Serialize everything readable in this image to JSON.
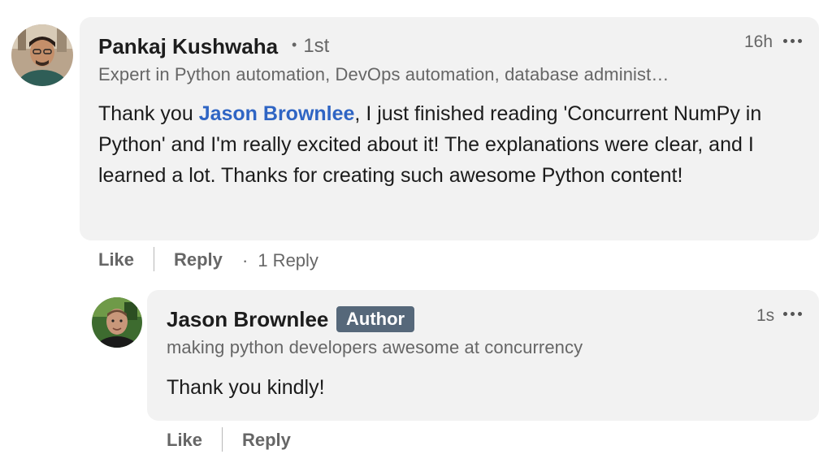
{
  "comment": {
    "author": "Pankaj Kushwaha",
    "degree": "1st",
    "headline": "Expert in Python automation, DevOps automation, database administ…",
    "time": "16h",
    "body_intro": "Thank you ",
    "mention": "Jason Brownlee",
    "body_rest": ", I just finished reading 'Concurrent NumPy in Python' and I'm really excited about it! The explanations were clear, and I learned a lot. Thanks for creating such awesome Python content!",
    "like_label": "Like",
    "reply_label": "Reply",
    "reply_count": "1 Reply",
    "more_icon": "more-dots-icon",
    "avatar_icon": "profile-photo"
  },
  "reply": {
    "author": "Jason Brownlee",
    "badge": "Author",
    "headline": "making python developers awesome at concurrency",
    "time": "1s",
    "body": "Thank you kindly!",
    "like_label": "Like",
    "reply_label": "Reply",
    "more_icon": "more-dots-icon",
    "avatar_icon": "profile-photo"
  },
  "colors": {
    "bubble_bg": "#f2f2f2",
    "mention": "#2f65c4",
    "badge_bg": "#56687a",
    "muted_text": "#666666"
  }
}
